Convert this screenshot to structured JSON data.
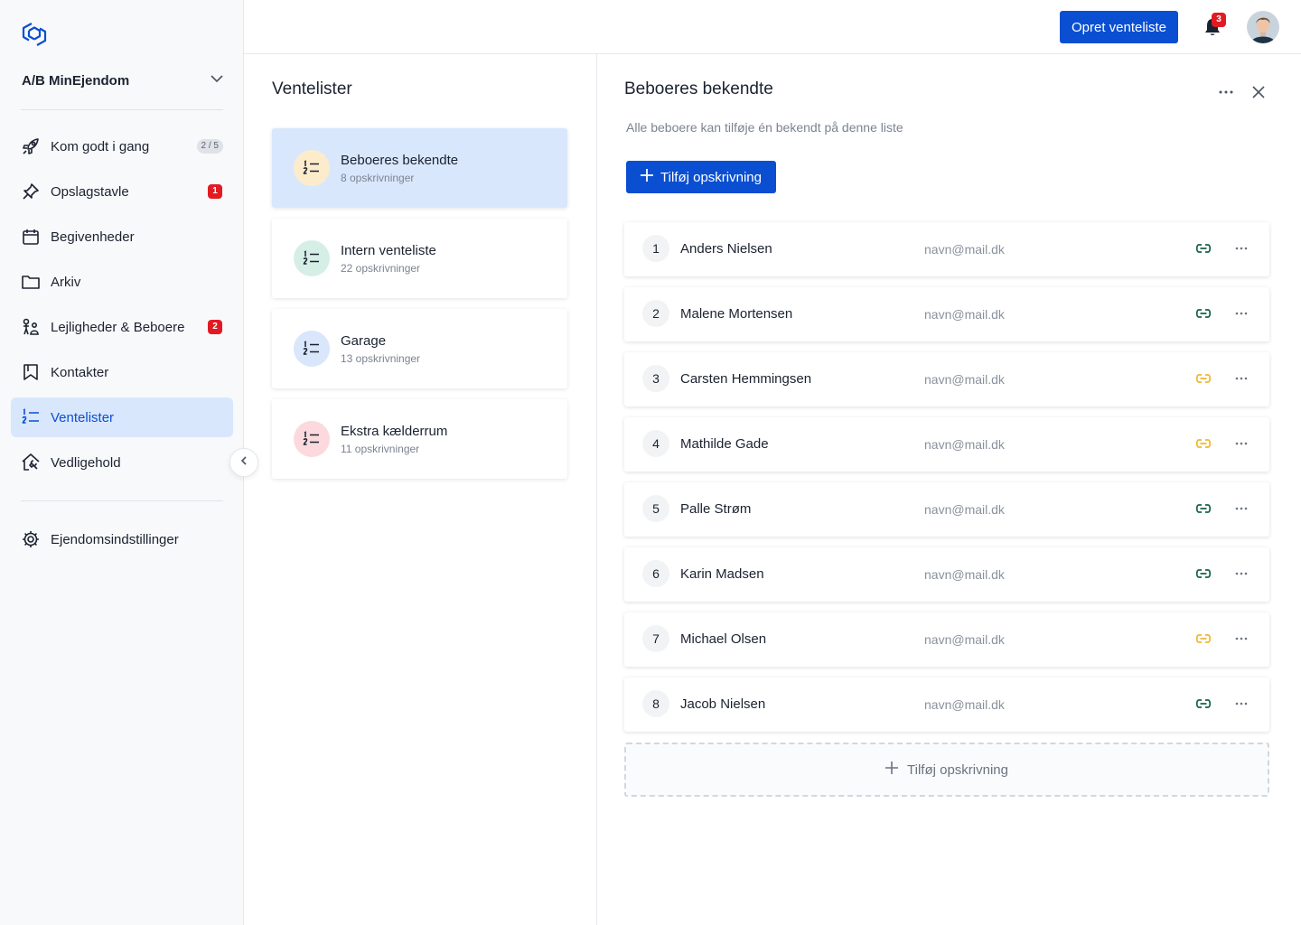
{
  "sidebar": {
    "org_name": "A/B MinEjendom",
    "items": [
      {
        "label": "Kom godt i gang",
        "icon": "rocket-icon",
        "badge": "2 / 5"
      },
      {
        "label": "Opslagstavle",
        "icon": "pin-icon",
        "badge_red": "1"
      },
      {
        "label": "Begivenheder",
        "icon": "calendar-icon"
      },
      {
        "label": "Arkiv",
        "icon": "folder-icon"
      },
      {
        "label": "Lejligheder & Beboere",
        "icon": "residents-icon",
        "badge_red": "2"
      },
      {
        "label": "Kontakter",
        "icon": "bookmark-icon"
      },
      {
        "label": "Ventelister",
        "icon": "numbered-list-icon",
        "active": true
      },
      {
        "label": "Vedligehold",
        "icon": "house-tool-icon"
      }
    ],
    "settings_label": "Ejendomsindstillinger"
  },
  "header": {
    "create_button": "Opret venteliste",
    "notification_count": "3"
  },
  "lists": {
    "title": "Ventelister",
    "items": [
      {
        "name": "Beboeres bekendte",
        "count": "8 opskrivninger",
        "color": "#fdeccb"
      },
      {
        "name": "Intern venteliste",
        "count": "22 opskrivninger",
        "color": "#d6efe6"
      },
      {
        "name": "Garage",
        "count": "13 opskrivninger",
        "color": "#d9e6fb"
      },
      {
        "name": "Ekstra kælderrum",
        "count": "11 opskrivninger",
        "color": "#fbd9dc"
      }
    ]
  },
  "detail": {
    "title": "Beboeres bekendte",
    "description": "Alle beboere kan tilføje én bekendt på denne liste",
    "add_button": "Tilføj opskrivning",
    "entries": [
      {
        "num": "1",
        "name": "Anders Nielsen",
        "email": "navn@mail.dk",
        "link_color": "#17624a"
      },
      {
        "num": "2",
        "name": "Malene Mortensen",
        "email": "navn@mail.dk",
        "link_color": "#17624a"
      },
      {
        "num": "3",
        "name": "Carsten Hemmingsen",
        "email": "navn@mail.dk",
        "link_color": "#f0b72f"
      },
      {
        "num": "4",
        "name": "Mathilde Gade",
        "email": "navn@mail.dk",
        "link_color": "#f0b72f"
      },
      {
        "num": "5",
        "name": "Palle Strøm",
        "email": "navn@mail.dk",
        "link_color": "#17624a"
      },
      {
        "num": "6",
        "name": "Karin Madsen",
        "email": "navn@mail.dk",
        "link_color": "#17624a"
      },
      {
        "num": "7",
        "name": "Michael Olsen",
        "email": "navn@mail.dk",
        "link_color": "#f0b72f"
      },
      {
        "num": "8",
        "name": "Jacob Nielsen",
        "email": "navn@mail.dk",
        "link_color": "#17624a"
      }
    ],
    "add_dashed": "Tilføj opskrivning"
  },
  "colors": {
    "accent": "#0a4fd1",
    "active_bg": "#d9e7fd",
    "danger": "#e21b23"
  }
}
